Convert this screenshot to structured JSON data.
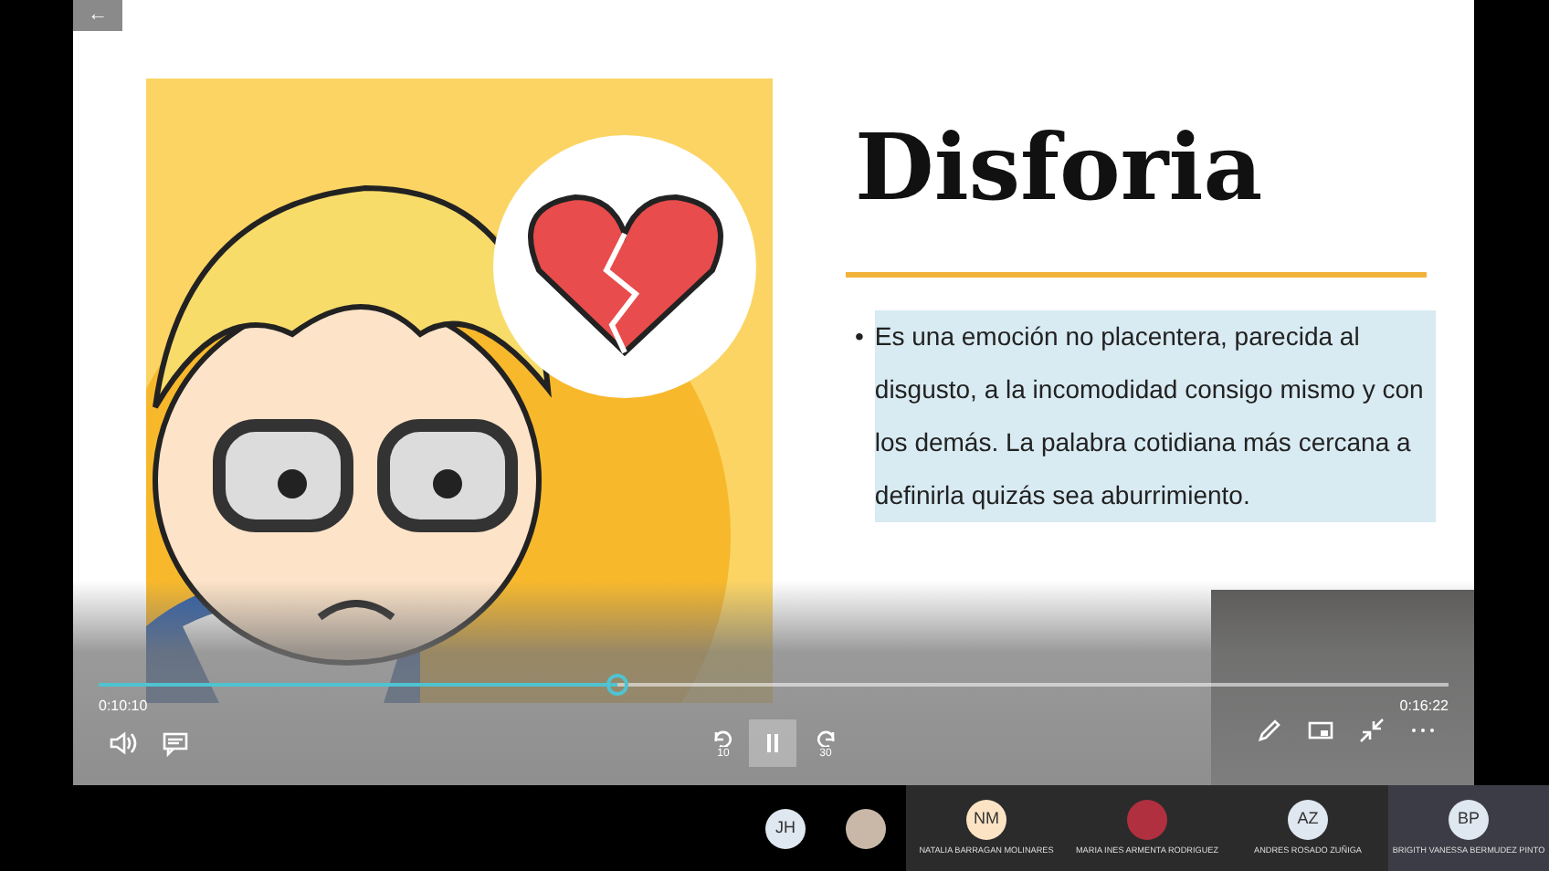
{
  "player": {
    "back": "←",
    "elapsed": "0:10:10",
    "duration": "0:16:22",
    "level": 0.384,
    "rewind_label": "10",
    "forward_label": "30",
    "pause_hovered": true
  },
  "slide": {
    "title": "Disforia",
    "bullet_mark": "•",
    "bullets": [
      "Es una emoción no placentera, parecida al disgusto, a la incomodidad consigo mismo y con los demás. La palabra cotidiana más cercana a definirla quizás sea aburrimiento."
    ]
  },
  "participants": [
    {
      "kind": "initials",
      "initials": "JH"
    },
    {
      "kind": "photo"
    },
    {
      "kind": "tile",
      "initials": "NM",
      "name": "NATALIA BARRAGAN MOLINARES",
      "selected": false
    },
    {
      "kind": "tile-photo",
      "name": "MARIA INES ARMENTA RODRIGUEZ",
      "selected": false
    },
    {
      "kind": "tile",
      "initials": "AZ",
      "name": "ANDRES ROSADO ZUÑIGA",
      "selected": false
    },
    {
      "kind": "tile",
      "initials": "BP",
      "name": "BRIGITH VANESSA BERMUDEZ PINTO",
      "selected": true
    }
  ]
}
